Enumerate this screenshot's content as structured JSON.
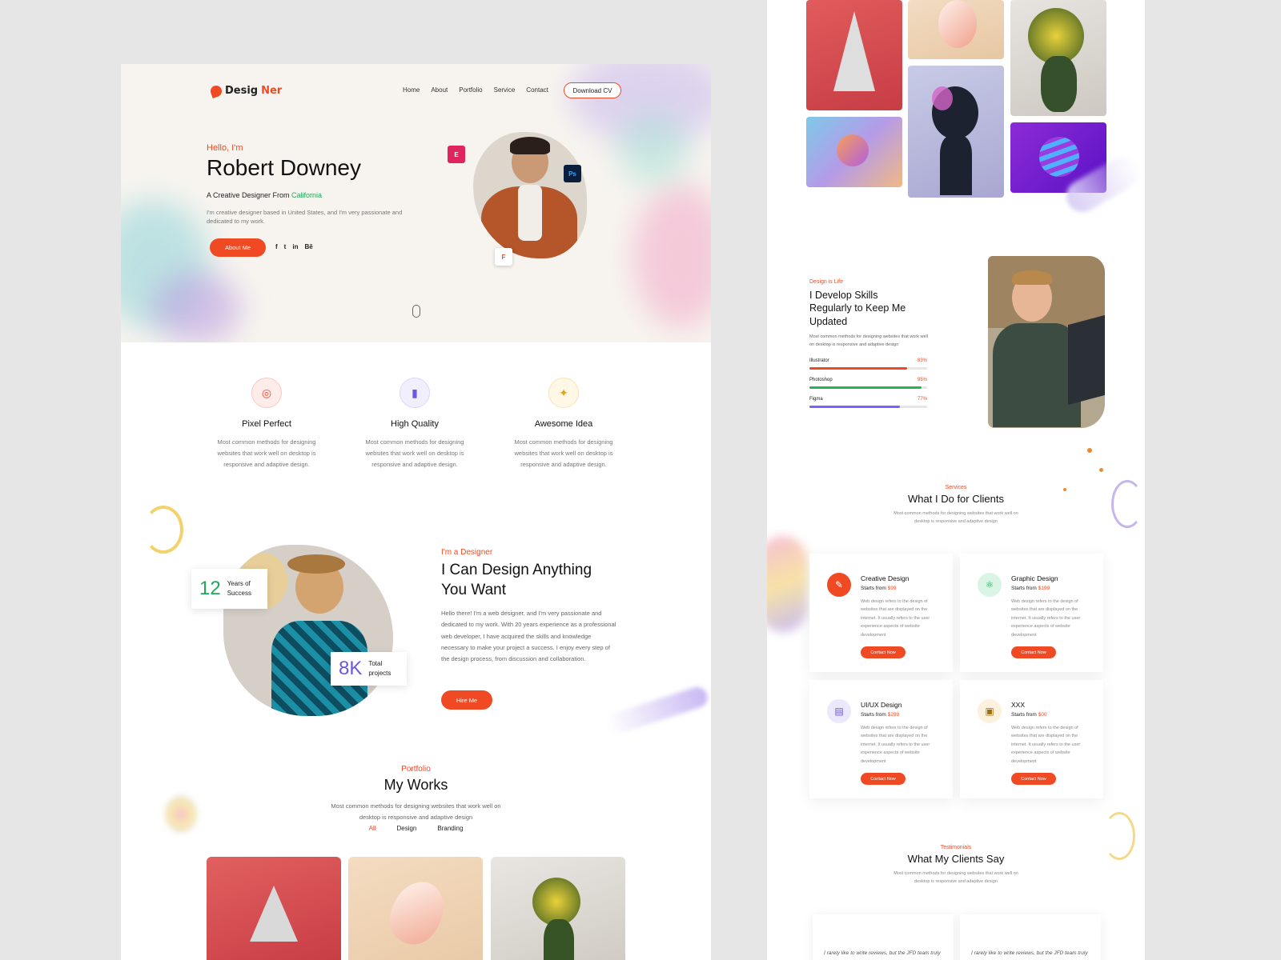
{
  "brand": {
    "logo_text_1": "Desig",
    "logo_text_2": "Ner",
    "accent": "#ef4a23",
    "green": "#22a65a"
  },
  "nav": {
    "items": [
      "Home",
      "About",
      "Portfolio",
      "Service",
      "Contact"
    ],
    "download_cv": "Download CV"
  },
  "hero": {
    "hello": "Hello, I'm",
    "name": "Robert Downey",
    "tagline_prefix": "A Creative Designer From ",
    "tagline_place": "California",
    "description": "I'm creative designer based in United States, and I'm very passionate and dedicated to my work.",
    "about_button": "About Me",
    "socials": [
      "f",
      "t",
      "in",
      "Bē"
    ],
    "badges": [
      "E",
      "Ps",
      "F"
    ]
  },
  "features": [
    {
      "title": "Pixel Perfect",
      "desc": "Most common methods for designing websites that work well on desktop is responsive and adaptive design.",
      "icon": "target-icon"
    },
    {
      "title": "High Quality",
      "desc": "Most common methods for designing websites that work well on desktop is responsive and adaptive design.",
      "icon": "brush-icon"
    },
    {
      "title": "Awesome Idea",
      "desc": "Most common methods for designing websites that work well on desktop is responsive and adaptive design.",
      "icon": "bulb-icon"
    }
  ],
  "about": {
    "eyebrow": "I'm a Designer",
    "heading_line1": "I Can Design Anything",
    "heading_line2": "You Want",
    "body": "Hello there! I'm a web designer, and I'm very passionate and dedicated to my work. With 20 years experience as a professional web developer, I have acquired the skills and knowledge necessary to make your project a success. I enjoy every step of the design process, from discussion and collaboration.",
    "hire_button": "Hire Me",
    "stat1_value": "12",
    "stat1_label": "Years of Success",
    "stat2_value": "8K",
    "stat2_label": "Total projects"
  },
  "portfolio": {
    "eyebrow": "Portfolio",
    "heading": "My Works",
    "desc": "Most common methods for designing websites that work well on desktop is responsive and adaptive design",
    "filters": [
      "All",
      "Design",
      "Branding"
    ]
  },
  "skills": {
    "eyebrow": "Design is Life",
    "heading_line1": "I Develop Skills",
    "heading_line2": "Regularly to Keep Me",
    "heading_line3": "Updated",
    "desc": "Most common methods for designing websites that work well on desktop is responsive and adaptive design",
    "items": [
      {
        "name": "Illustrator",
        "pct_label": "83%",
        "value": 83,
        "color": "#ef4a23"
      },
      {
        "name": "Photoshop",
        "pct_label": "95%",
        "value": 95,
        "color": "#22b45a"
      },
      {
        "name": "Figma",
        "pct_label": "77%",
        "value": 77,
        "color": "#7b61ff"
      }
    ]
  },
  "services": {
    "eyebrow": "Services",
    "heading": "What I Do for Clients",
    "desc_line1": "Most common methods for designing websites that work well on",
    "desc_line2": "desktop is responsive and adaptive design",
    "starts_from": "Starts from ",
    "card_desc": "Web design refers to the design of websites that are displayed on the internet. It usually refers to the user experience aspects of website development",
    "contact_button": "Contact Now",
    "items": [
      {
        "title": "Creative Design",
        "price": "$99",
        "icon": "design-icon"
      },
      {
        "title": "Graphic Design",
        "price": "$199",
        "icon": "atom-icon"
      },
      {
        "title": "UI/UX Design",
        "price": "$299",
        "icon": "layout-icon"
      },
      {
        "title": "XXX",
        "price": "$00",
        "icon": "window-icon"
      }
    ]
  },
  "testimonials": {
    "eyebrow": "Testimonials",
    "heading": "What My Clients Say",
    "desc_line1": "Most common methods for designing websites that work well on",
    "desc_line2": "desktop is responsive and adaptive design",
    "quote_start": "I rarely like to write reviews, but the JFD team truly"
  }
}
